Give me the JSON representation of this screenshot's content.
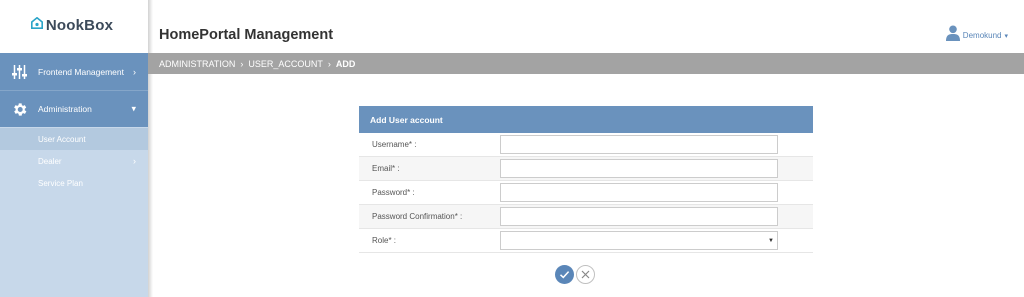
{
  "brand": {
    "name": "NookBox",
    "icon": "nookbox-logo-icon"
  },
  "header": {
    "title": "HomePortal Management",
    "user": "Demokund"
  },
  "sidebar": {
    "items": [
      {
        "label": "Frontend Management",
        "icon": "sliders-icon"
      },
      {
        "label": "Administration",
        "icon": "gear-icon"
      }
    ],
    "subitems": [
      {
        "label": "User Account"
      },
      {
        "label": "Dealer"
      },
      {
        "label": "Service Plan"
      }
    ]
  },
  "breadcrumb": {
    "items": [
      "ADMINISTRATION",
      "USER_ACCOUNT",
      "ADD"
    ]
  },
  "form": {
    "title": "Add User account",
    "fields": [
      {
        "label": "Username* :",
        "value": ""
      },
      {
        "label": "Email* :",
        "value": ""
      },
      {
        "label": "Password* :",
        "value": ""
      },
      {
        "label": "Password Confirmation* :",
        "value": ""
      },
      {
        "label": "Role* :",
        "value": ""
      }
    ]
  },
  "colors": {
    "primary": "#6a92bd",
    "sidebar_bg": "#c7d8ea",
    "breadcrumb_bg": "#a3a3a3",
    "link": "#5a86b8"
  }
}
